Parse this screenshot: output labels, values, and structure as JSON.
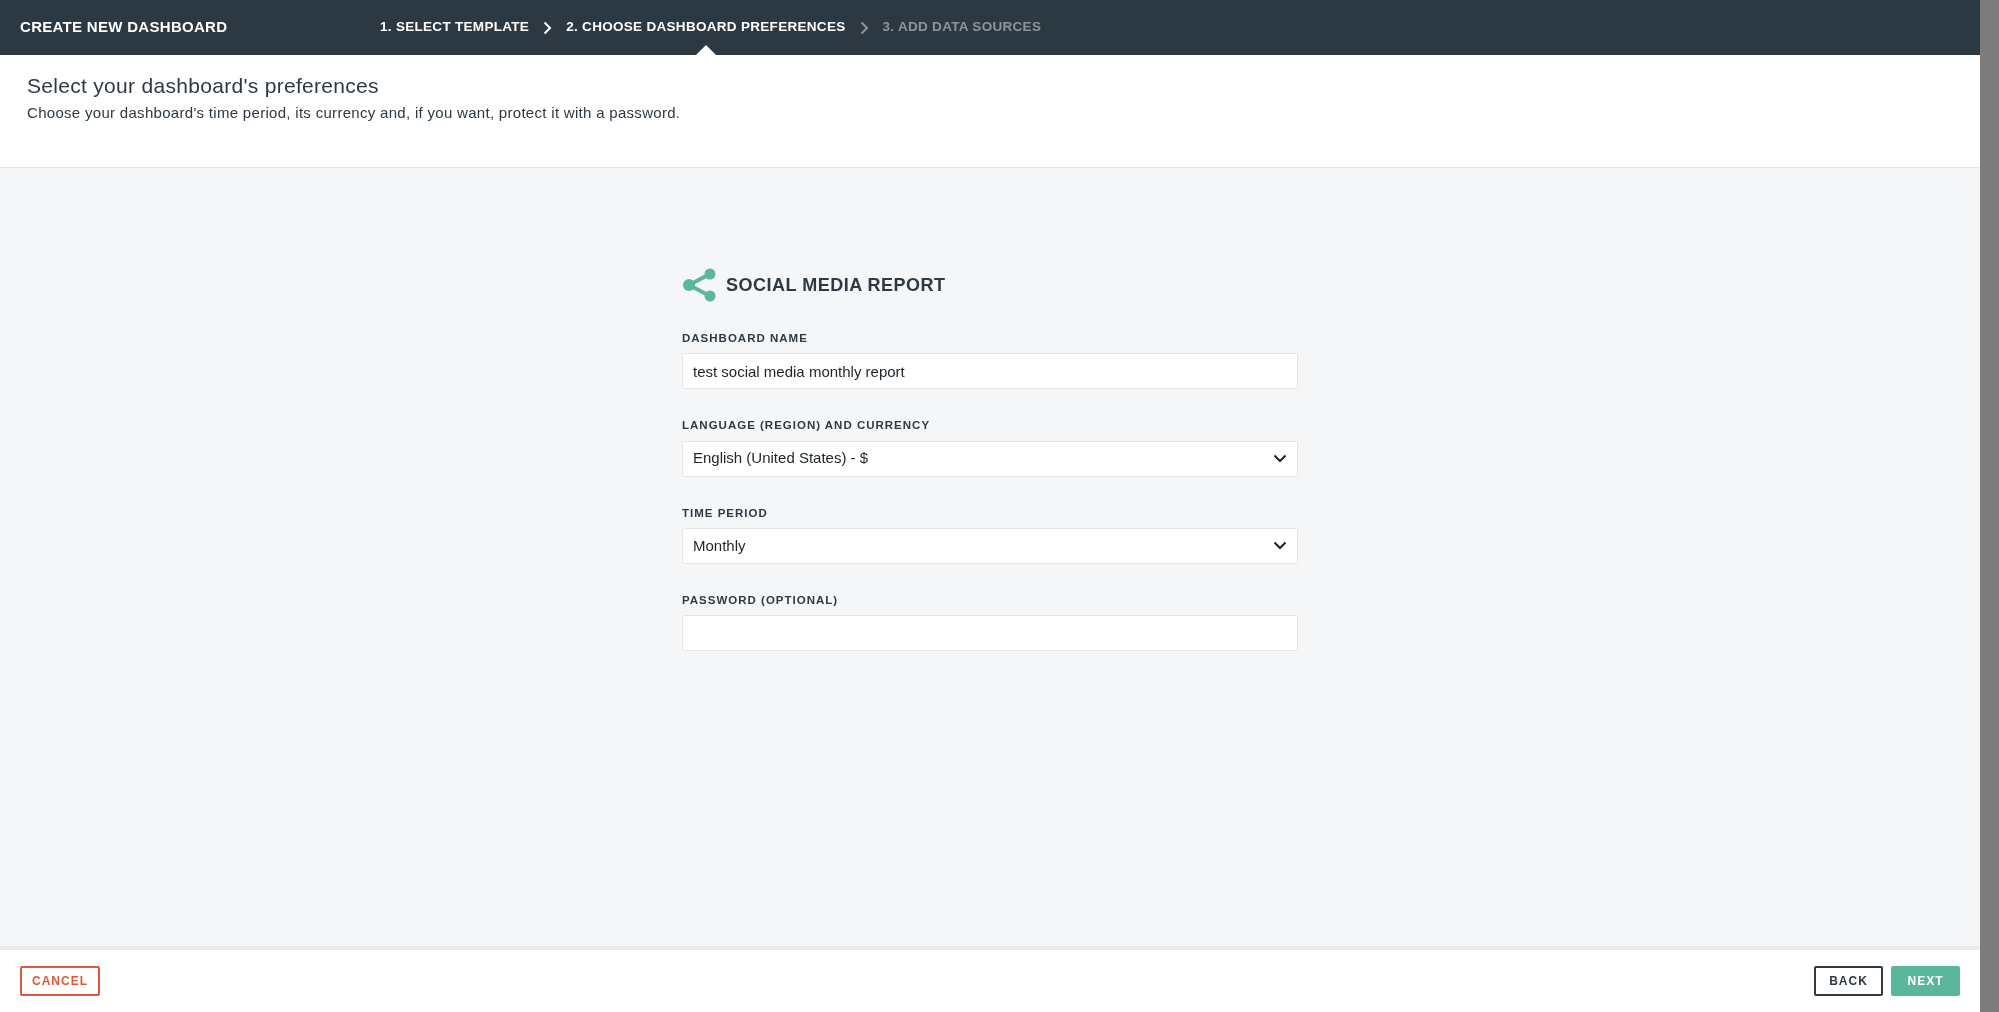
{
  "window": {
    "title": "CREATE NEW DASHBOARD"
  },
  "steps": [
    {
      "label": "1. SELECT TEMPLATE",
      "disabled": false,
      "selected": false
    },
    {
      "label": "2. CHOOSE DASHBOARD PREFERENCES",
      "disabled": false,
      "selected": true
    },
    {
      "label": "3. ADD DATA SOURCES",
      "disabled": true,
      "selected": false
    }
  ],
  "header": {
    "title": "Select your dashboard's preferences",
    "subtitle": "Choose your dashboard's time period, its currency and, if you want, protect it with a password."
  },
  "form": {
    "title": "SOCIAL MEDIA REPORT",
    "fields": [
      {
        "kind": "text",
        "label": "DASHBOARD NAME",
        "value": "test social media monthly report"
      },
      {
        "kind": "select",
        "label": "LANGUAGE (REGION) AND CURRENCY",
        "value": "English (United States) - $"
      },
      {
        "kind": "select",
        "label": "TIME PERIOD",
        "value": "Monthly"
      },
      {
        "kind": "password",
        "label": "PASSWORD (OPTIONAL)"
      }
    ]
  },
  "footer": {
    "cancel": "CANCEL",
    "back": "BACK",
    "next": "NEXT"
  }
}
